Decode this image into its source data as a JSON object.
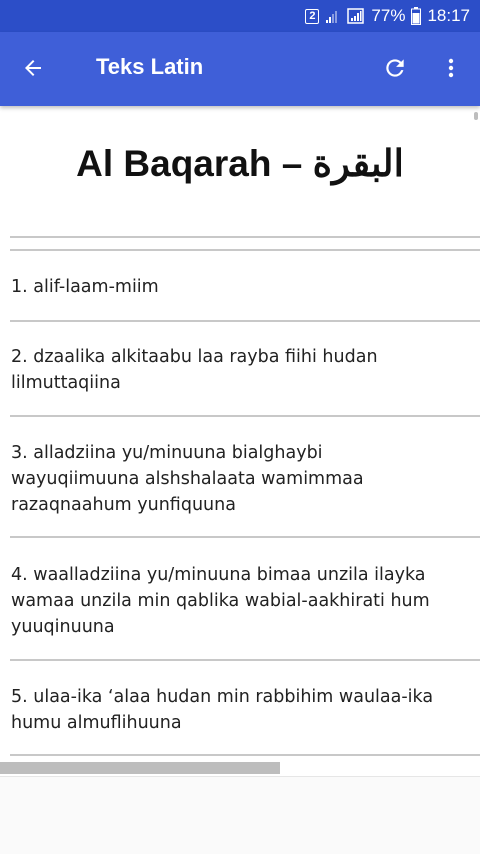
{
  "status_bar": {
    "sim_label": "2",
    "battery": "77%",
    "time": "18:17"
  },
  "app_bar": {
    "title": "Teks Latin",
    "icons": {
      "back": "arrow-back-icon",
      "refresh": "refresh-icon",
      "more": "more-vert-icon"
    }
  },
  "content": {
    "surah_title": "Al Baqarah – البقرة",
    "verses": [
      {
        "lines": [
          "1. alif-laam-miim"
        ]
      },
      {
        "lines": [
          "2. dzaalika alkitaabu laa rayba fiihi hudan",
          "lilmuttaqiina"
        ]
      },
      {
        "lines": [
          "3. alladziina yu/minuuna bialghaybi",
          "wayuqiimuuna alshshalaata wamimmaa",
          "razaqnaahum yunfiquuna"
        ]
      },
      {
        "lines": [
          "4. waalladziina yu/minuuna bimaa unzila ilayka",
          "wamaa unzila min qablika wabial-aakhirati hum",
          "yuuqinuuna"
        ]
      },
      {
        "lines": [
          "5. ulaa-ika ‘alaa hudan min rabbihim waulaa-ika",
          "humu almuflihuuna"
        ]
      }
    ]
  },
  "colors": {
    "status_bar": "#2c4ec8",
    "app_bar": "#3f5fd8",
    "divider": "#c8c8c8",
    "text": "#222222"
  }
}
